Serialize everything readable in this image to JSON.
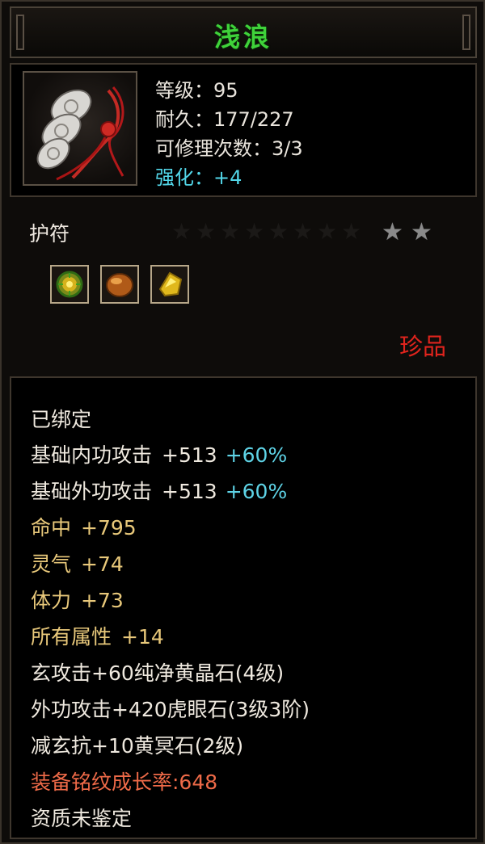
{
  "item": {
    "name": "浅浪",
    "level": "等级：95",
    "durability": "耐久：177/227",
    "repair": "可修理次数：3/3",
    "enhance": "强化：+4",
    "type": "护符",
    "stars_filled": 2,
    "quality": "珍品"
  },
  "gems": [
    "green-gem-icon",
    "amber-gem-icon",
    "yellow-crystal-icon"
  ],
  "attributes": {
    "bound": "已绑定",
    "internal_attack": {
      "label": "基础内功攻击",
      "value": "+513",
      "pct": "+60%"
    },
    "external_attack": {
      "label": "基础外功攻击",
      "value": "+513",
      "pct": "+60%"
    },
    "hit": {
      "label": "命中",
      "value": "+795"
    },
    "spirit": {
      "label": "灵气",
      "value": "+74"
    },
    "stamina": {
      "label": "体力",
      "value": "+73"
    },
    "all_attr": {
      "label": "所有属性",
      "value": "+14"
    },
    "gem_1": "玄攻击+60纯净黄晶石(4级)",
    "gem_2": "外功攻击+420虎眼石(3级3阶)",
    "gem_3": "减玄抗+10黄冥石(2级)",
    "growth": "装备铭纹成长率:648",
    "aptitude": "资质未鉴定"
  },
  "colors": {
    "title_green": "#3fd23a",
    "enhance_cyan": "#52d6e8",
    "quality_red": "#e0241d",
    "attr_gold": "#e8c87a",
    "growth_orange": "#ee6a48"
  }
}
